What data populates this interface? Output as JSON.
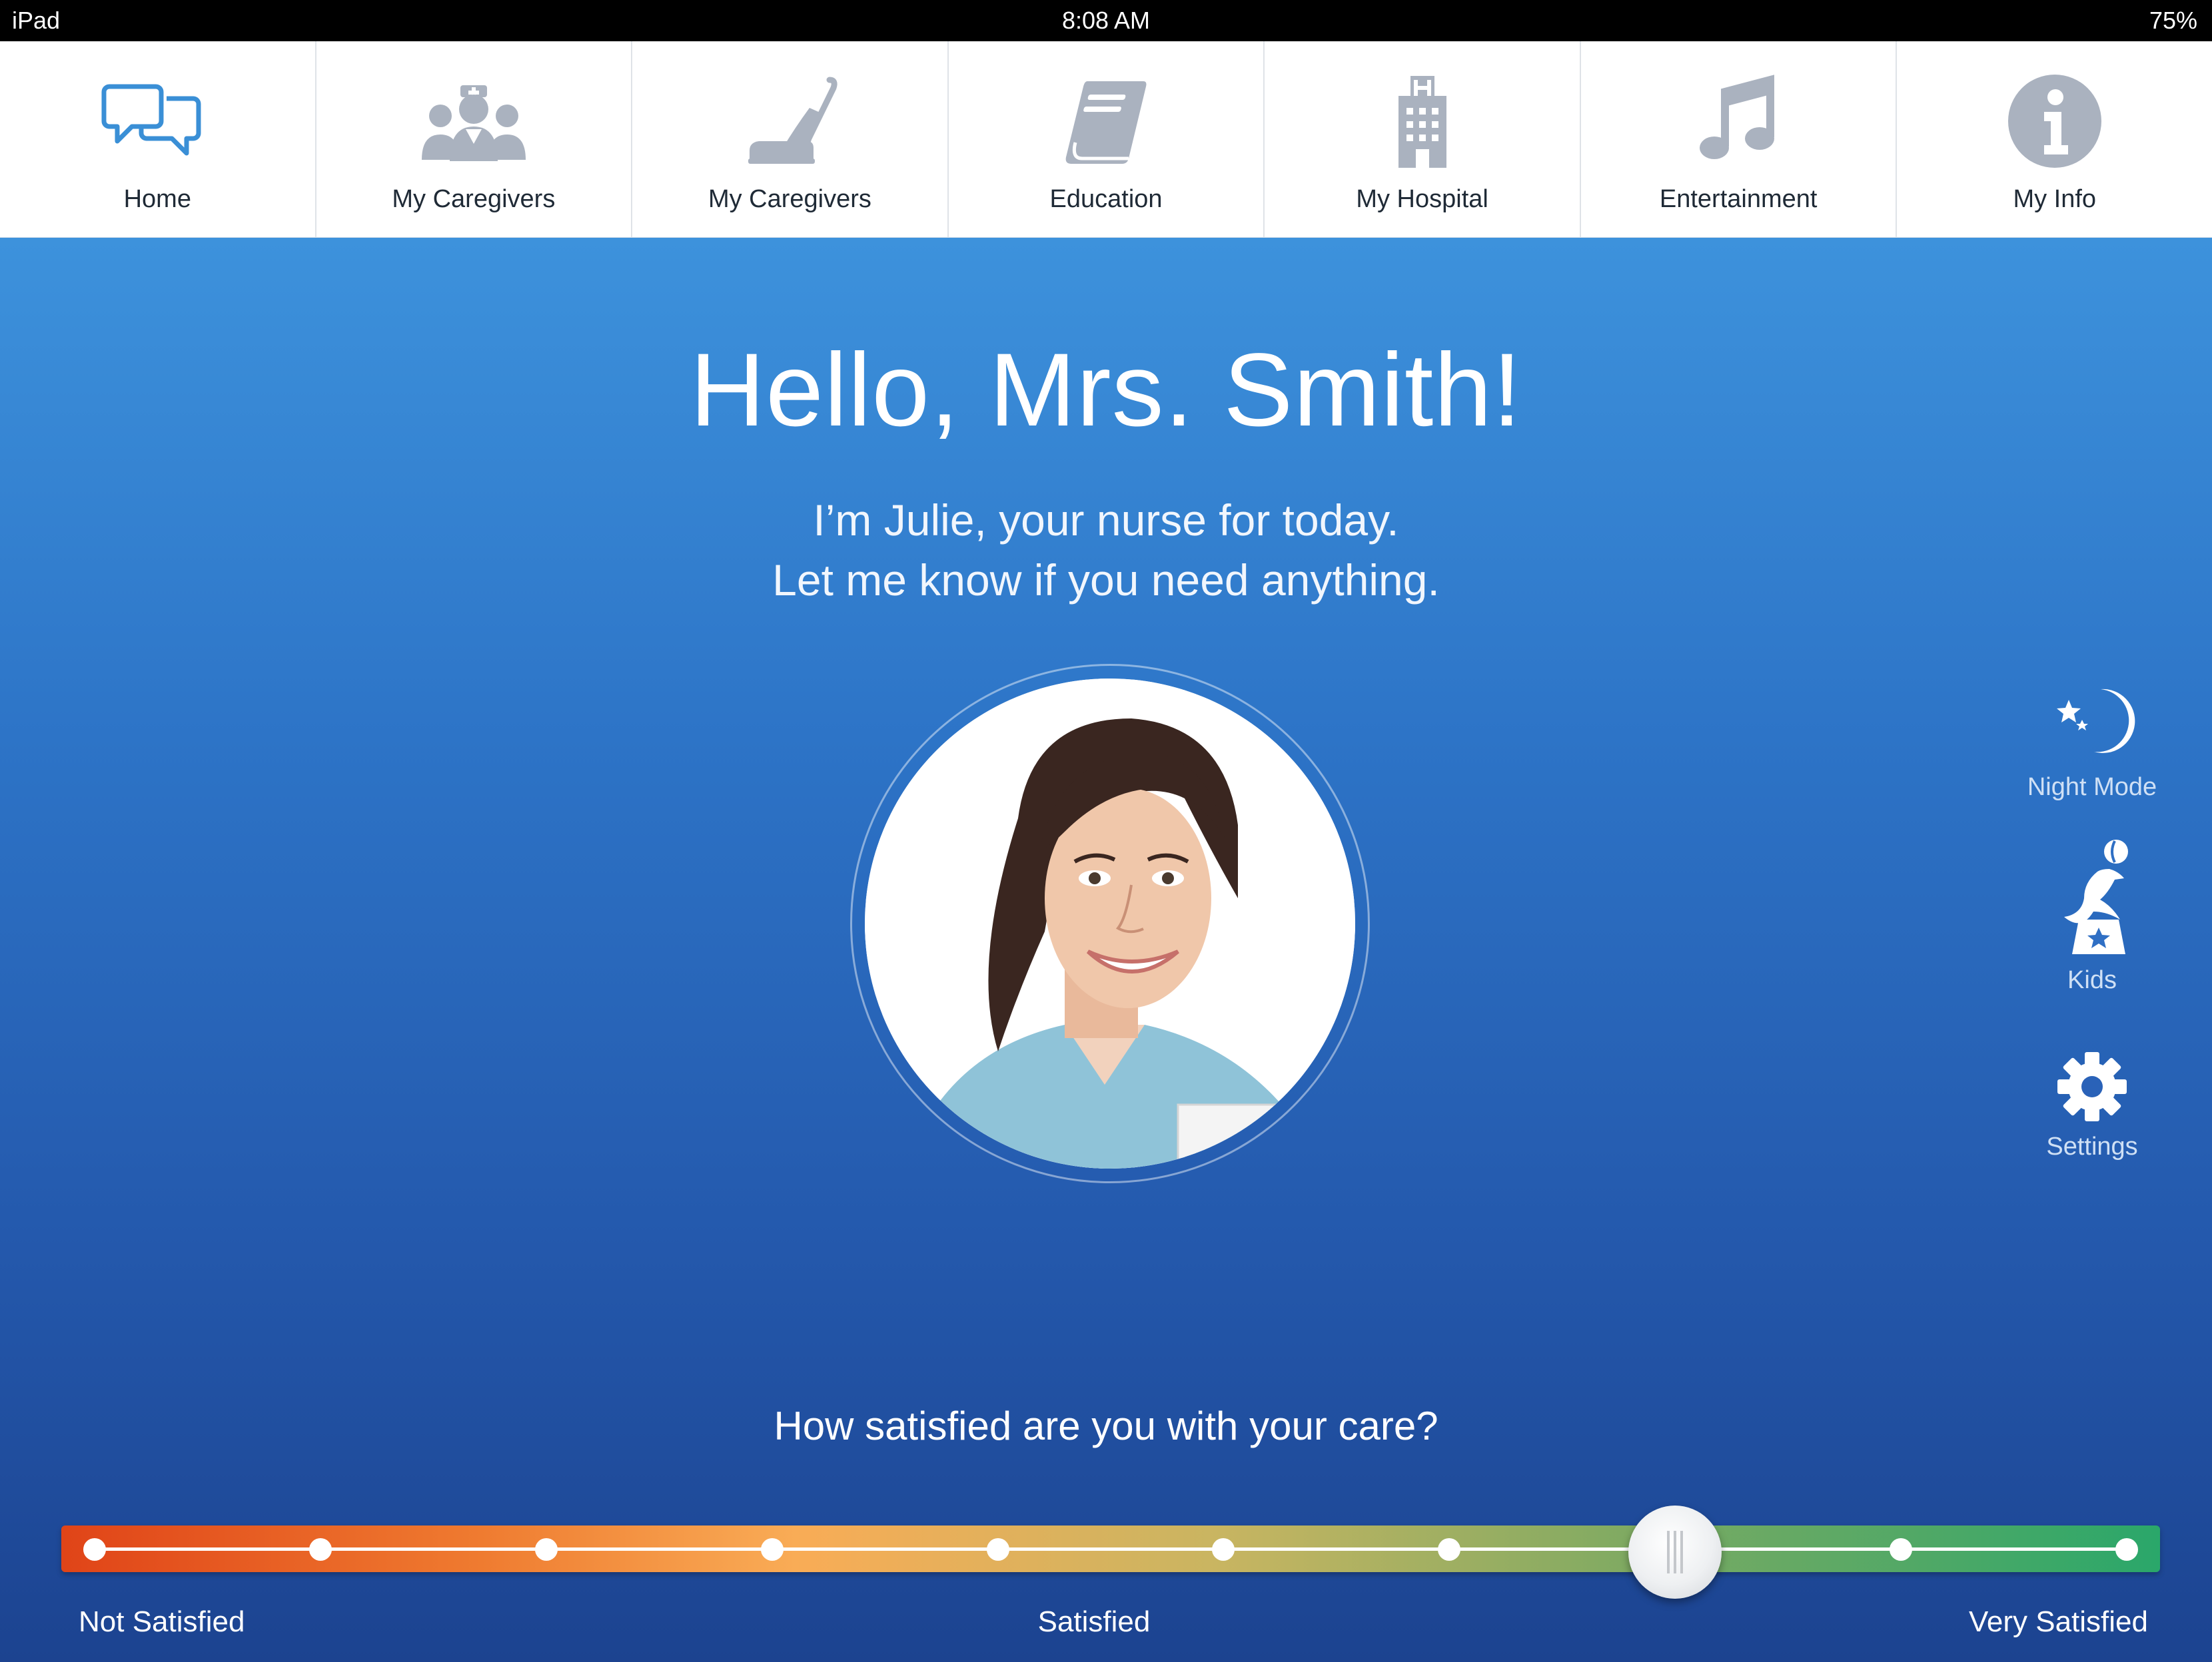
{
  "status_bar": {
    "device": "iPad",
    "time": "8:08 AM",
    "battery": "75%"
  },
  "nav": {
    "items": [
      {
        "label": "Home",
        "icon": "chat-bubbles-icon",
        "active": true
      },
      {
        "label": "My Caregivers",
        "icon": "caregivers-icon"
      },
      {
        "label": "My Caregivers",
        "icon": "vacuum-icon"
      },
      {
        "label": "Education",
        "icon": "book-icon"
      },
      {
        "label": "My Hospital",
        "icon": "hospital-icon"
      },
      {
        "label": "Entertainment",
        "icon": "music-note-icon"
      },
      {
        "label": "My Info",
        "icon": "info-icon"
      }
    ]
  },
  "main": {
    "greeting": "Hello, Mrs. Smith!",
    "subline_1": "I’m Julie, your nurse for today.",
    "subline_2": "Let me know if you need anything.",
    "nurse_photo": "nurse-avatar"
  },
  "side_buttons": [
    {
      "label": "Night Mode",
      "icon": "moon-stars-icon"
    },
    {
      "label": "Kids",
      "icon": "seal-ball-icon"
    },
    {
      "label": "Settings",
      "icon": "gear-icon"
    }
  ],
  "satisfaction": {
    "question": "How satisfied are you with your care?",
    "steps": 10,
    "selected_step": 7,
    "labels": {
      "low": "Not Satisfied",
      "mid": "Satisfied",
      "high": "Very Satisfied"
    }
  },
  "colors": {
    "nav_icon_active": "#3a8fd6",
    "nav_icon_inactive": "#aab2bf",
    "background_top": "#3d92dc",
    "background_bottom": "#1c4390",
    "slider_low": "#e04418",
    "slider_high": "#2aa76a"
  }
}
